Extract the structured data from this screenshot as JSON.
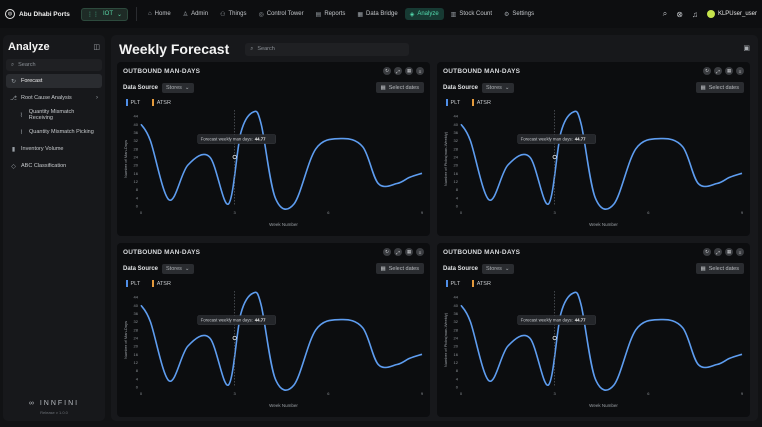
{
  "brand": {
    "name": "Abu Dhabi Ports",
    "logo_icon": "globe-icon"
  },
  "env": {
    "label": "IOT"
  },
  "nav": [
    {
      "label": "Home",
      "icon": "home-icon",
      "glyph": "⌂",
      "active": false
    },
    {
      "label": "Admin",
      "icon": "user-icon",
      "glyph": "♙",
      "active": false
    },
    {
      "label": "Things",
      "icon": "network-icon",
      "glyph": "⚇",
      "active": false
    },
    {
      "label": "Control Tower",
      "icon": "tower-icon",
      "glyph": "◎",
      "active": false
    },
    {
      "label": "Reports",
      "icon": "reports-icon",
      "glyph": "▤",
      "active": false
    },
    {
      "label": "Data Bridge",
      "icon": "bridge-icon",
      "glyph": "▦",
      "active": false
    },
    {
      "label": "Analyze",
      "icon": "analyze-icon",
      "glyph": "◈",
      "active": true
    },
    {
      "label": "Stock Count",
      "icon": "stock-icon",
      "glyph": "▥",
      "active": false
    },
    {
      "label": "Settings",
      "icon": "gear-icon",
      "glyph": "⚙",
      "active": false
    }
  ],
  "user": {
    "name": "KLPUser_user"
  },
  "sidebar": {
    "title": "Analyze",
    "search_placeholder": "Search",
    "items": [
      {
        "label": "Forecast",
        "icon": "forecast-icon",
        "glyph": "↻",
        "active": true,
        "sub": false,
        "chevron": false
      },
      {
        "label": "Root Cause Analysis",
        "icon": "root-cause-icon",
        "glyph": "⎇",
        "active": false,
        "sub": false,
        "chevron": true
      },
      {
        "label": "Quantity Mismatch Receiving",
        "icon": "mismatch-icon",
        "glyph": "⌇",
        "active": false,
        "sub": true,
        "chevron": false
      },
      {
        "label": "Quantity Mismatch Picking",
        "icon": "mismatch-icon",
        "glyph": "⌇",
        "active": false,
        "sub": true,
        "chevron": false
      },
      {
        "label": "Inventory Volume",
        "icon": "bar-chart-icon",
        "glyph": "▮",
        "active": false,
        "sub": false,
        "chevron": false
      },
      {
        "label": "ABC Classification",
        "icon": "classification-icon",
        "glyph": "◇",
        "active": false,
        "sub": false,
        "chevron": false
      }
    ],
    "footer_logo": "INNFINI",
    "footer_version": "Release v 1.0.0"
  },
  "main": {
    "title": "Weekly Forecast",
    "search_placeholder": "Search"
  },
  "colors": {
    "accent": "#53d9ad",
    "plt": "#4f8ee8",
    "atsr": "#e49a3c",
    "line": "#5e9df0"
  },
  "cards": [
    {
      "title": "OUTBOUND MAN-DAYS",
      "ds_label": "Data Source",
      "ds_value": "Stores",
      "date_label": "Select dates",
      "legend": [
        "PLT",
        "ATSR"
      ],
      "ylabel": "Number of Man-Days",
      "xlabel": "Week Number",
      "tooltip_label": "Forecast weekly man days:",
      "tooltip_value": "44.77"
    },
    {
      "title": "OUTBOUND MAN-DAYS",
      "ds_label": "Data Source",
      "ds_value": "Stores",
      "date_label": "Select dates",
      "legend": [
        "PLT",
        "ATSR"
      ],
      "ylabel": "Number of Picks(man-Weekly)",
      "xlabel": "Week Number",
      "tooltip_label": "Forecast weekly man days:",
      "tooltip_value": "44.77"
    },
    {
      "title": "OUTBOUND MAN-DAYS",
      "ds_label": "Data Source",
      "ds_value": "Stores",
      "date_label": "Select dates",
      "legend": [
        "PLT",
        "ATSR"
      ],
      "ylabel": "Number of Man-Days",
      "xlabel": "Week Number",
      "tooltip_label": "Forecast weekly man days:",
      "tooltip_value": "44.77"
    },
    {
      "title": "OUTBOUND MAN-DAYS",
      "ds_label": "Data Source",
      "ds_value": "Stores",
      "date_label": "Select dates",
      "legend": [
        "PLT",
        "ATSR"
      ],
      "ylabel": "Number of Picks(man-Weekly)",
      "xlabel": "Week Number",
      "tooltip_label": "Forecast weekly man days:",
      "tooltip_value": "44.77"
    }
  ],
  "chart_data": {
    "type": "line",
    "xlabel": "Week Number",
    "xticks": [
      0,
      3,
      6,
      9
    ],
    "yticks": [
      0,
      4,
      8,
      12,
      16,
      20,
      24,
      28,
      32,
      36,
      40,
      44
    ],
    "ylim": [
      0,
      46
    ],
    "xlim": [
      0,
      9
    ],
    "series": [
      {
        "x": [
          0,
          0.3,
          0.9,
          1.5,
          2.2,
          2.8,
          3.2,
          3.6,
          3.85,
          4.3,
          4.9,
          5.6,
          6.4,
          7.1,
          7.6,
          8.2,
          8.6,
          9.0
        ],
        "y": [
          40,
          32,
          3,
          20,
          24,
          1,
          36,
          46,
          40,
          4,
          1,
          28,
          33,
          29,
          11,
          11,
          14,
          16
        ]
      }
    ],
    "highlight": {
      "x": 3,
      "y": 24,
      "label": "Forecast weekly man days:",
      "value": 44.77
    }
  }
}
